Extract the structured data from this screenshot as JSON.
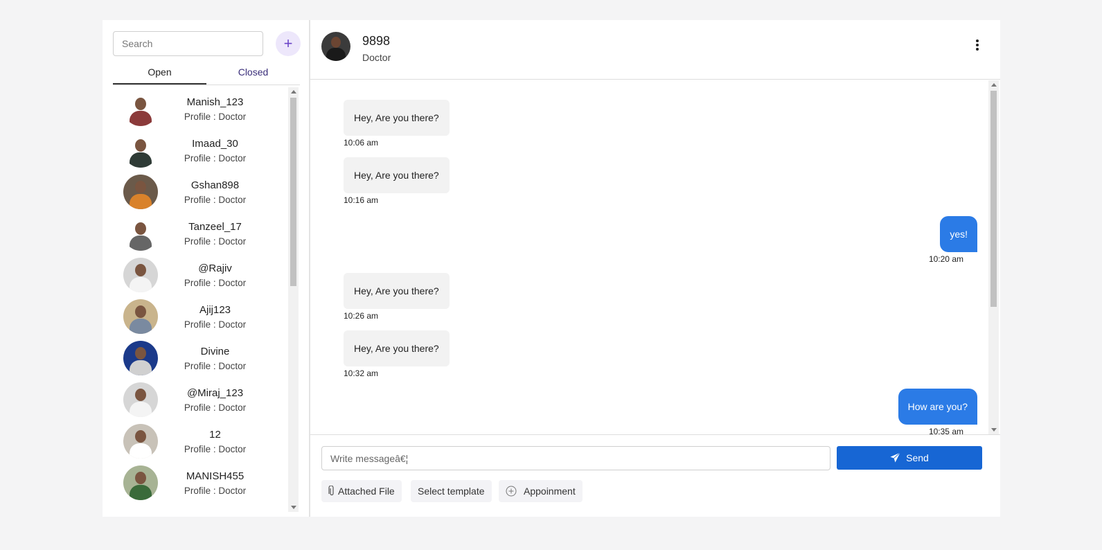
{
  "sidebar": {
    "search_placeholder": "Search",
    "add_icon": "+",
    "tabs": [
      {
        "label": "Open"
      },
      {
        "label": "Closed"
      }
    ],
    "contacts": [
      {
        "name": "Manish_123",
        "profile": "Profile : Doctor",
        "bg": "#ffffff",
        "shirt": "#8b3a3a"
      },
      {
        "name": "Imaad_30",
        "profile": "Profile : Doctor",
        "bg": "#ffffff",
        "shirt": "#2f3b36"
      },
      {
        "name": "Gshan898",
        "profile": "Profile : Doctor",
        "bg": "#6b5a4a",
        "shirt": "#d9822b"
      },
      {
        "name": "Tanzeel_17",
        "profile": "Profile : Doctor",
        "bg": "#ffffff",
        "shirt": "#666666"
      },
      {
        "name": "@Rajiv",
        "profile": "Profile : Doctor",
        "bg": "#d6d6d6",
        "shirt": "#f4f4f4"
      },
      {
        "name": "Ajij123",
        "profile": "Profile : Doctor",
        "bg": "#c9b48c",
        "shirt": "#7a8aa0"
      },
      {
        "name": "Divine",
        "profile": "Profile : Doctor",
        "bg": "#1b3a8a",
        "shirt": "#d0d0d0"
      },
      {
        "name": "@Miraj_123",
        "profile": "Profile : Doctor",
        "bg": "#d6d6d6",
        "shirt": "#f4f4f4"
      },
      {
        "name": "12",
        "profile": "Profile : Doctor",
        "bg": "#c8c2b8",
        "shirt": "#ffffff"
      },
      {
        "name": "MANISH455",
        "profile": "Profile : Doctor",
        "bg": "#a7b394",
        "shirt": "#3a6b3a"
      }
    ]
  },
  "header": {
    "name": "9898",
    "role": "Doctor"
  },
  "messages": [
    {
      "text": "Hey, Are you there?",
      "time": "10:06 am",
      "dir": "in"
    },
    {
      "text": "Hey, Are you there?",
      "time": "10:16 am",
      "dir": "in"
    },
    {
      "text": "yes!",
      "time": "10:20 am",
      "dir": "out"
    },
    {
      "text": "Hey, Are you there?",
      "time": "10:26 am",
      "dir": "in"
    },
    {
      "text": "Hey, Are you there?",
      "time": "10:32 am",
      "dir": "in"
    },
    {
      "text": "How are you?",
      "time": "10:35 am",
      "dir": "out"
    }
  ],
  "composer": {
    "placeholder": "Write messageâ€¦",
    "send_label": "Send",
    "attach_label": "Attached File",
    "template_label": "Select template",
    "appointment_label": "Appoinment"
  },
  "colors": {
    "accent": "#1766d4",
    "outgoing_bubble": "#2b7be6",
    "incoming_bubble": "#f2f2f2"
  }
}
